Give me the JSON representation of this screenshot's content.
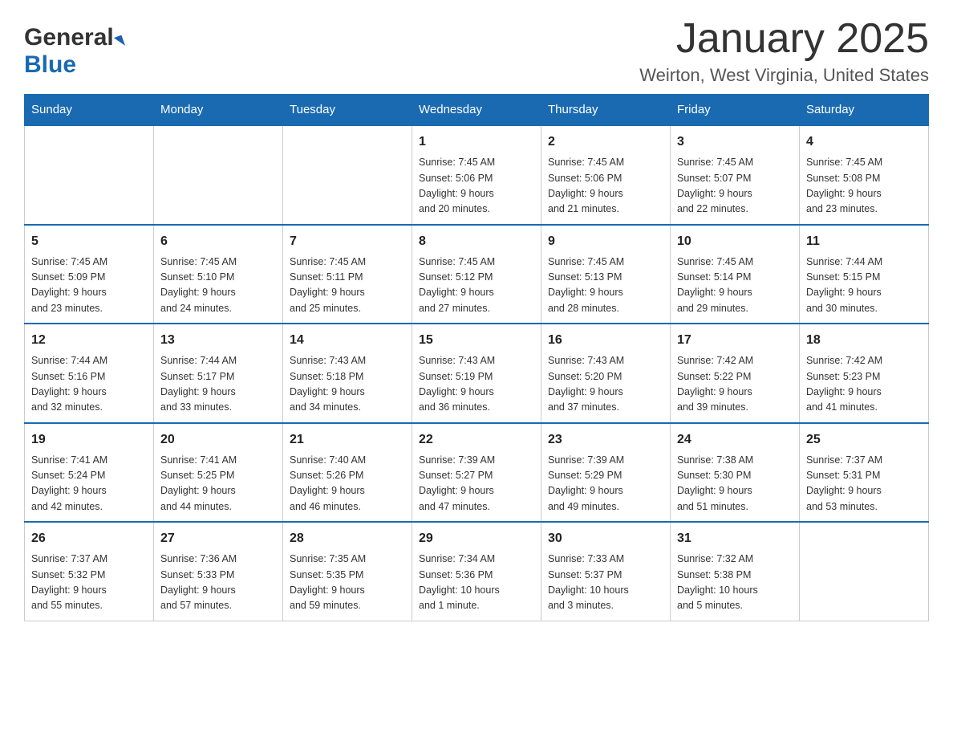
{
  "header": {
    "logo_general": "General",
    "logo_blue": "Blue",
    "month_title": "January 2025",
    "location": "Weirton, West Virginia, United States"
  },
  "days_of_week": [
    "Sunday",
    "Monday",
    "Tuesday",
    "Wednesday",
    "Thursday",
    "Friday",
    "Saturday"
  ],
  "weeks": [
    [
      {
        "day": "",
        "info": ""
      },
      {
        "day": "",
        "info": ""
      },
      {
        "day": "",
        "info": ""
      },
      {
        "day": "1",
        "info": "Sunrise: 7:45 AM\nSunset: 5:06 PM\nDaylight: 9 hours\nand 20 minutes."
      },
      {
        "day": "2",
        "info": "Sunrise: 7:45 AM\nSunset: 5:06 PM\nDaylight: 9 hours\nand 21 minutes."
      },
      {
        "day": "3",
        "info": "Sunrise: 7:45 AM\nSunset: 5:07 PM\nDaylight: 9 hours\nand 22 minutes."
      },
      {
        "day": "4",
        "info": "Sunrise: 7:45 AM\nSunset: 5:08 PM\nDaylight: 9 hours\nand 23 minutes."
      }
    ],
    [
      {
        "day": "5",
        "info": "Sunrise: 7:45 AM\nSunset: 5:09 PM\nDaylight: 9 hours\nand 23 minutes."
      },
      {
        "day": "6",
        "info": "Sunrise: 7:45 AM\nSunset: 5:10 PM\nDaylight: 9 hours\nand 24 minutes."
      },
      {
        "day": "7",
        "info": "Sunrise: 7:45 AM\nSunset: 5:11 PM\nDaylight: 9 hours\nand 25 minutes."
      },
      {
        "day": "8",
        "info": "Sunrise: 7:45 AM\nSunset: 5:12 PM\nDaylight: 9 hours\nand 27 minutes."
      },
      {
        "day": "9",
        "info": "Sunrise: 7:45 AM\nSunset: 5:13 PM\nDaylight: 9 hours\nand 28 minutes."
      },
      {
        "day": "10",
        "info": "Sunrise: 7:45 AM\nSunset: 5:14 PM\nDaylight: 9 hours\nand 29 minutes."
      },
      {
        "day": "11",
        "info": "Sunrise: 7:44 AM\nSunset: 5:15 PM\nDaylight: 9 hours\nand 30 minutes."
      }
    ],
    [
      {
        "day": "12",
        "info": "Sunrise: 7:44 AM\nSunset: 5:16 PM\nDaylight: 9 hours\nand 32 minutes."
      },
      {
        "day": "13",
        "info": "Sunrise: 7:44 AM\nSunset: 5:17 PM\nDaylight: 9 hours\nand 33 minutes."
      },
      {
        "day": "14",
        "info": "Sunrise: 7:43 AM\nSunset: 5:18 PM\nDaylight: 9 hours\nand 34 minutes."
      },
      {
        "day": "15",
        "info": "Sunrise: 7:43 AM\nSunset: 5:19 PM\nDaylight: 9 hours\nand 36 minutes."
      },
      {
        "day": "16",
        "info": "Sunrise: 7:43 AM\nSunset: 5:20 PM\nDaylight: 9 hours\nand 37 minutes."
      },
      {
        "day": "17",
        "info": "Sunrise: 7:42 AM\nSunset: 5:22 PM\nDaylight: 9 hours\nand 39 minutes."
      },
      {
        "day": "18",
        "info": "Sunrise: 7:42 AM\nSunset: 5:23 PM\nDaylight: 9 hours\nand 41 minutes."
      }
    ],
    [
      {
        "day": "19",
        "info": "Sunrise: 7:41 AM\nSunset: 5:24 PM\nDaylight: 9 hours\nand 42 minutes."
      },
      {
        "day": "20",
        "info": "Sunrise: 7:41 AM\nSunset: 5:25 PM\nDaylight: 9 hours\nand 44 minutes."
      },
      {
        "day": "21",
        "info": "Sunrise: 7:40 AM\nSunset: 5:26 PM\nDaylight: 9 hours\nand 46 minutes."
      },
      {
        "day": "22",
        "info": "Sunrise: 7:39 AM\nSunset: 5:27 PM\nDaylight: 9 hours\nand 47 minutes."
      },
      {
        "day": "23",
        "info": "Sunrise: 7:39 AM\nSunset: 5:29 PM\nDaylight: 9 hours\nand 49 minutes."
      },
      {
        "day": "24",
        "info": "Sunrise: 7:38 AM\nSunset: 5:30 PM\nDaylight: 9 hours\nand 51 minutes."
      },
      {
        "day": "25",
        "info": "Sunrise: 7:37 AM\nSunset: 5:31 PM\nDaylight: 9 hours\nand 53 minutes."
      }
    ],
    [
      {
        "day": "26",
        "info": "Sunrise: 7:37 AM\nSunset: 5:32 PM\nDaylight: 9 hours\nand 55 minutes."
      },
      {
        "day": "27",
        "info": "Sunrise: 7:36 AM\nSunset: 5:33 PM\nDaylight: 9 hours\nand 57 minutes."
      },
      {
        "day": "28",
        "info": "Sunrise: 7:35 AM\nSunset: 5:35 PM\nDaylight: 9 hours\nand 59 minutes."
      },
      {
        "day": "29",
        "info": "Sunrise: 7:34 AM\nSunset: 5:36 PM\nDaylight: 10 hours\nand 1 minute."
      },
      {
        "day": "30",
        "info": "Sunrise: 7:33 AM\nSunset: 5:37 PM\nDaylight: 10 hours\nand 3 minutes."
      },
      {
        "day": "31",
        "info": "Sunrise: 7:32 AM\nSunset: 5:38 PM\nDaylight: 10 hours\nand 5 minutes."
      },
      {
        "day": "",
        "info": ""
      }
    ]
  ]
}
